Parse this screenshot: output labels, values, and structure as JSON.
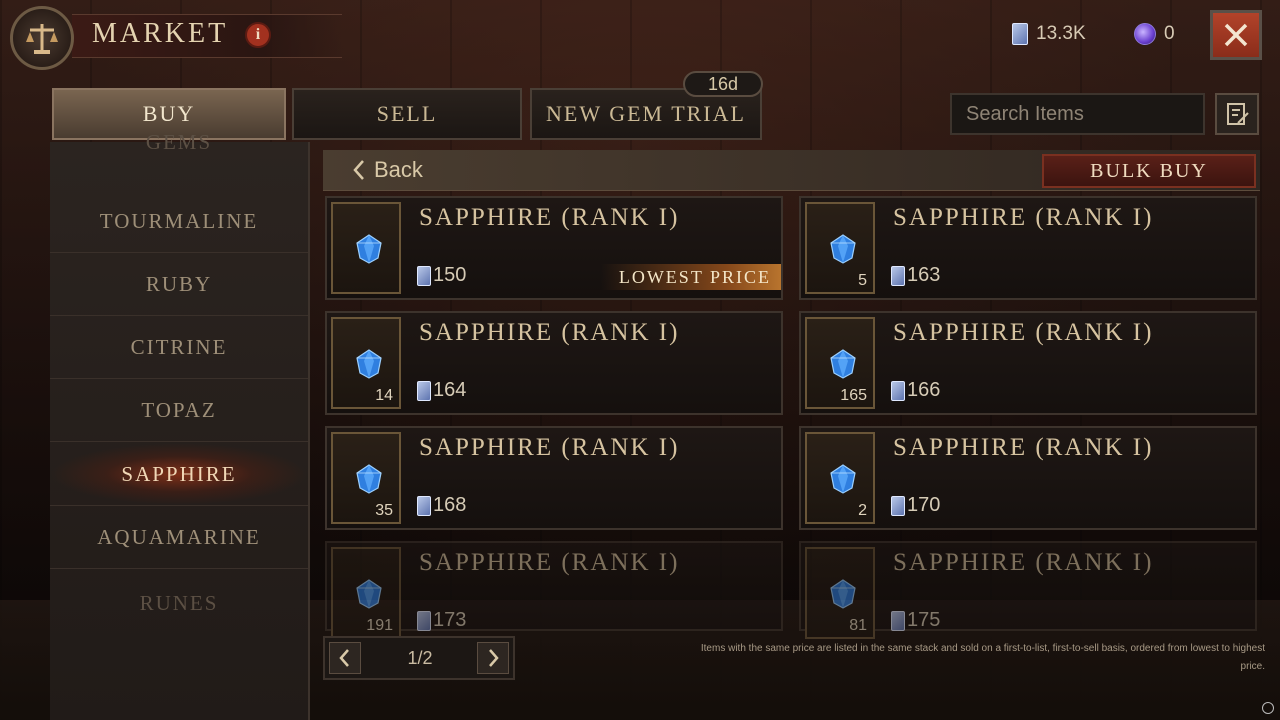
{
  "header": {
    "title": "MARKET",
    "info_label": "i",
    "platinum": "13.3K",
    "orbs": "0",
    "close_label": "close"
  },
  "tabs": {
    "buy": "BUY",
    "sell": "SELL",
    "gem_trial": "NEW GEM TRIAL",
    "gem_trial_badge": "16d"
  },
  "search": {
    "placeholder": "Search Items"
  },
  "sidebar": {
    "items": [
      {
        "label": "GEMS"
      },
      {
        "label": "TOURMALINE"
      },
      {
        "label": "RUBY"
      },
      {
        "label": "CITRINE"
      },
      {
        "label": "TOPAZ"
      },
      {
        "label": "SAPPHIRE"
      },
      {
        "label": "AQUAMARINE"
      },
      {
        "label": "RUNES"
      }
    ],
    "active": "SAPPHIRE"
  },
  "list_header": {
    "back_label": "Back",
    "bulk_buy_label": "BULK BUY"
  },
  "listings": [
    {
      "name": "SAPPHIRE (RANK I)",
      "qty": "",
      "price": "150",
      "tag": "LOWEST PRICE"
    },
    {
      "name": "SAPPHIRE (RANK I)",
      "qty": "5",
      "price": "163",
      "tag": ""
    },
    {
      "name": "SAPPHIRE (RANK I)",
      "qty": "14",
      "price": "164",
      "tag": ""
    },
    {
      "name": "SAPPHIRE (RANK I)",
      "qty": "165",
      "price": "166",
      "tag": ""
    },
    {
      "name": "SAPPHIRE (RANK I)",
      "qty": "35",
      "price": "168",
      "tag": ""
    },
    {
      "name": "SAPPHIRE (RANK I)",
      "qty": "2",
      "price": "170",
      "tag": ""
    },
    {
      "name": "SAPPHIRE (RANK I)",
      "qty": "191",
      "price": "173",
      "tag": ""
    },
    {
      "name": "SAPPHIRE (RANK I)",
      "qty": "81",
      "price": "175",
      "tag": ""
    }
  ],
  "pagination": {
    "label": "1/2"
  },
  "footnote": "Items with the same price are listed in the same stack and sold on a first-to-list, first-to-sell basis, ordered from lowest to highest price.",
  "colors": {
    "accent_red": "#a2311f",
    "gem_blue": "#3a8ee8",
    "gold_border": "#6a5638"
  },
  "icons": {
    "emblem": "scales-icon",
    "platinum": "platinum-icon",
    "orb": "orb-icon",
    "close": "close-icon",
    "search": "search-icon",
    "filter": "filter-icon",
    "gem": "sapphire-gem-icon"
  }
}
